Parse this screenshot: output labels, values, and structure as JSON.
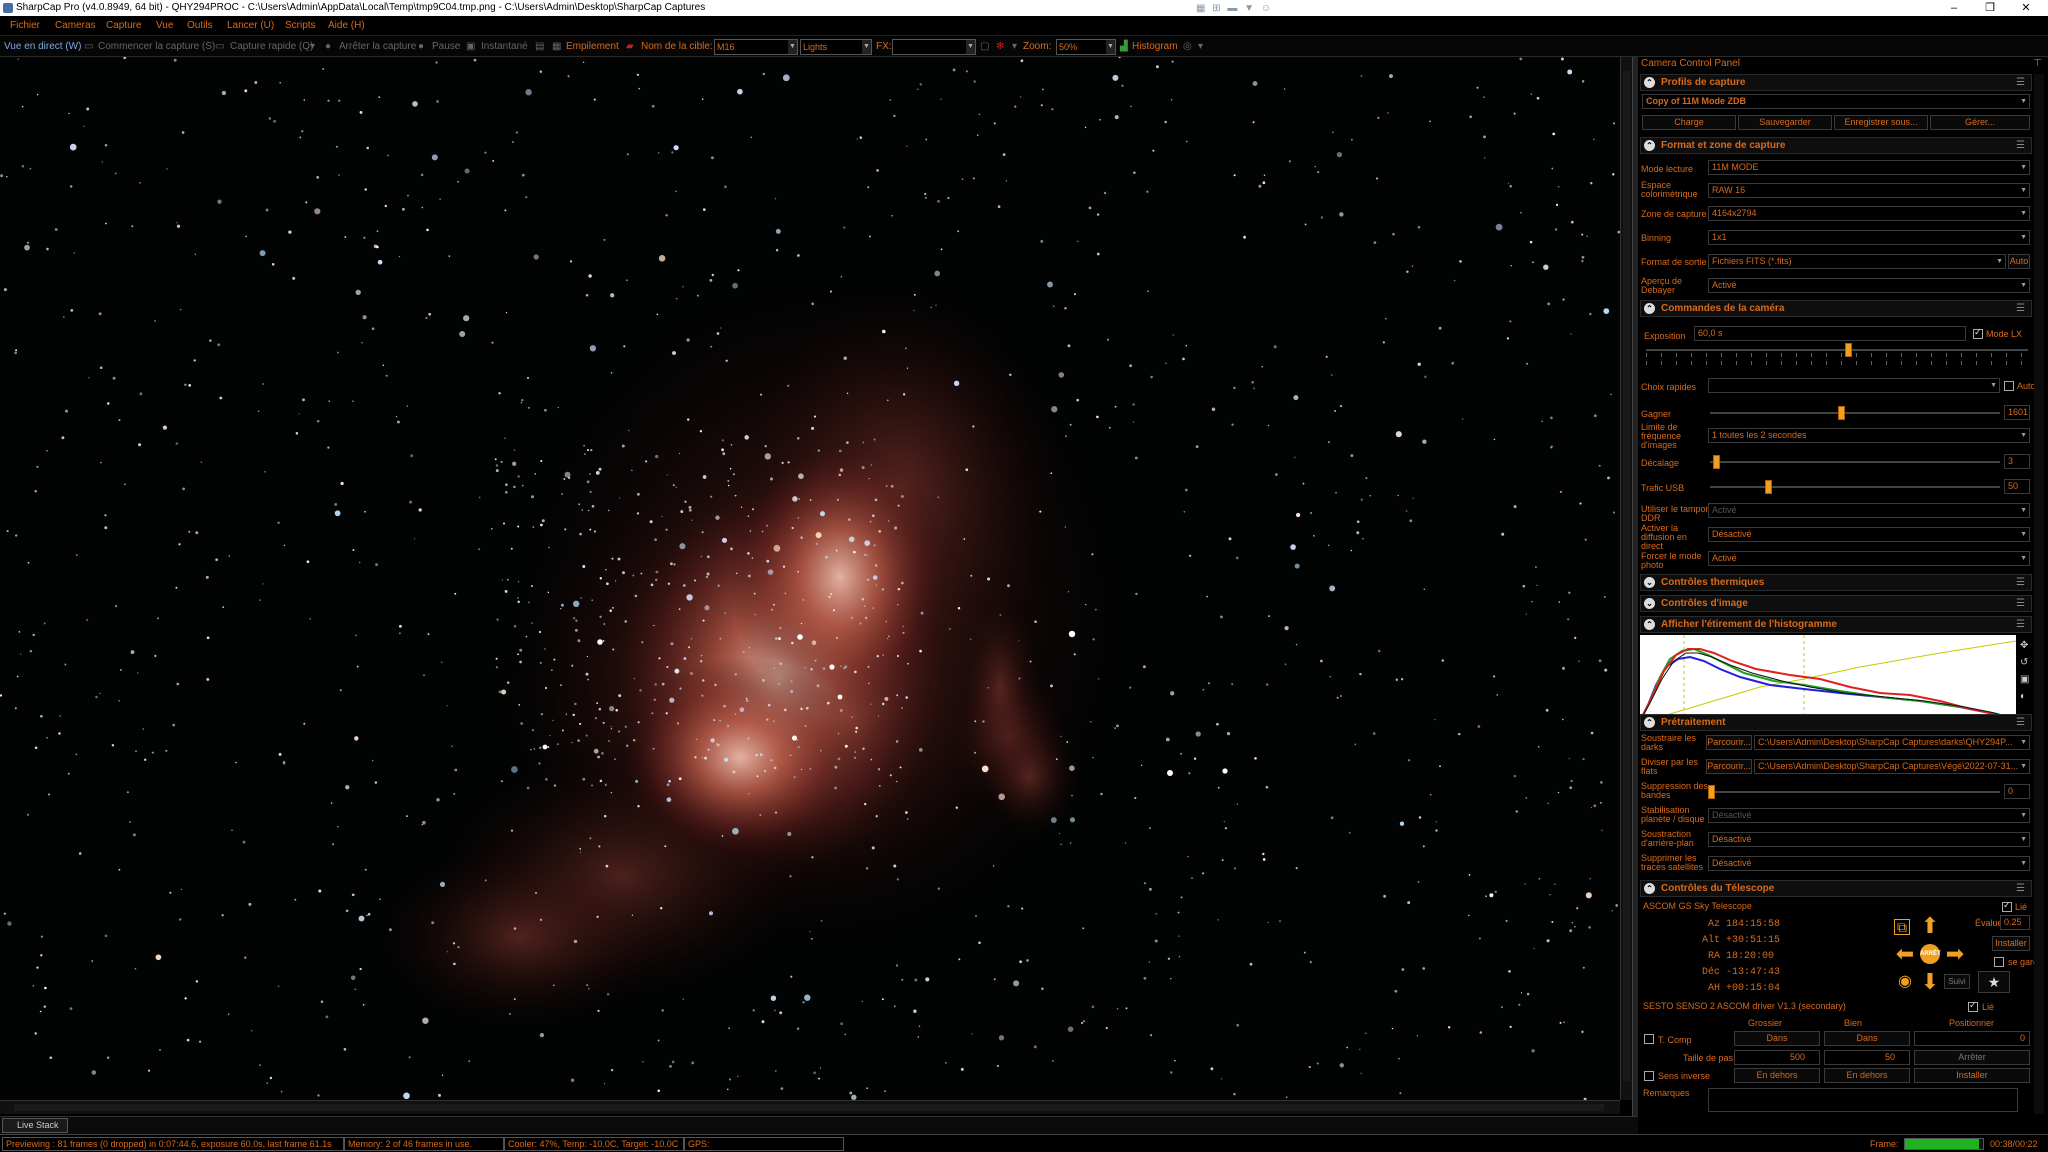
{
  "window": {
    "title": "SharpCap Pro (v4.0.8949, 64 bit) - QHY294PROC - C:\\Users\\Admin\\AppData\\Local\\Temp\\tmp9C04.tmp.png - C:\\Users\\Admin\\Desktop\\SharpCap Captures",
    "min": "–",
    "max": "❐",
    "close": "✕",
    "extra_icons": "▦ ⊞ ▬ ▼ ☺"
  },
  "menu": [
    "Fichier",
    "Cameras",
    "Capture",
    "Vue",
    "Outils",
    "Lancer (U)",
    "Scripts",
    "Aide (H)"
  ],
  "toolbar": {
    "live": "Vue en direct (W)",
    "start_capture": "Commencer la capture (S)",
    "quick_capture": "Capture rapide (Q)",
    "stop_capture": "Arrêter la capture",
    "pause": "Pause",
    "snapshot": "Instantané",
    "stack": "Empilement",
    "target_label": "Nom de la cible:",
    "target_value": "M16",
    "frame_type": "Lights",
    "fx_label": "FX:",
    "fx_value": "",
    "zoom_label": "Zoom:",
    "zoom_value": "50%",
    "histogram": "Histogram"
  },
  "bottom_tab": "Live Stack",
  "status": {
    "preview": "Previewing : 81 frames (0 dropped) in 0:07:44.6, exposure 60.0s, last frame 61.1s",
    "memory": "Memory: 2 of 46 frames in use.",
    "cooler": "Cooler: 47%, Temp: -10.0C, Target: -10.0C",
    "gps": "GPS:",
    "frame_label": "Frame:",
    "frame_progress": 0.95,
    "frame_time": "00:38/00:22"
  },
  "panel": {
    "title": "Camera Control Panel",
    "pin": "⊤",
    "profiles": {
      "header": "Profils de capture",
      "value": "Copy of 11M Mode ZDB",
      "buttons": [
        "Charge",
        "Sauvegarder",
        "Enregistrer sous...",
        "Gérer..."
      ]
    },
    "format": {
      "header": "Format et zone de capture",
      "rows": [
        {
          "label": "Mode lecture",
          "value": "11M MODE"
        },
        {
          "label": "Espace colorimétrique",
          "value": "RAW 16"
        },
        {
          "label": "Zone de capture",
          "value": "4164x2794"
        },
        {
          "label": "Binning",
          "value": "1x1"
        },
        {
          "label": "Format de sortie",
          "value": "Fichiers FITS (*.fits)",
          "extra": "Auto"
        },
        {
          "label": "Aperçu de Debayer",
          "value": "Activé"
        }
      ]
    },
    "camera": {
      "header": "Commandes de la caméra",
      "exposure_label": "Exposition",
      "exposure_value": "60,0 s",
      "lx_label": "Mode LX",
      "quick_label": "Choix rapides",
      "quick_value": "",
      "auto_label": "Auto",
      "gain_label": "Gagner",
      "gain_value": "1601",
      "gain_level": 0.45,
      "limit_label": "Limite de fréquence d'images",
      "limit_value": "1 toutes les 2 secondes",
      "offset_label": "Décalage",
      "offset_value": "3",
      "offset_level": 0.02,
      "usb_label": "Trafic USB",
      "usb_value": "50",
      "usb_level": 0.2,
      "exposure_level": 0.53,
      "ddr_label": "Utiliser le tampon DDR",
      "ddr_value": "Activé",
      "diffusion_label": "Activer la diffusion en direct",
      "diffusion_value": "Désactivé",
      "photo_label": "Forcer le mode photo",
      "photo_value": "Activé"
    },
    "thermal_header": "Contrôles thermiques",
    "image_header": "Contrôles d'image",
    "histogram_header": "Afficher l'étirement de l'histogramme",
    "preprocessing": {
      "header": "Prétraitement",
      "browse": "Parcourir...",
      "darks_label": "Soustraire les darks",
      "darks_value": "C:\\Users\\Admin\\Desktop\\SharpCap Captures\\darks\\QHY294P...",
      "flats_label": "Diviser par les flats",
      "flats_value": "C:\\Users\\Admin\\Desktop\\SharpCap Captures\\Végé\\2022-07-31...",
      "banding_label": "Suppression des bandes",
      "banding_value": "0",
      "stab_label": "Stabilisation planète / disque",
      "stab_value": "Désactivé",
      "bg_label": "Soustraction d'arrière-plan",
      "bg_value": "Désactivé",
      "sat_label": "Supprimer les traces satellites",
      "sat_value": "Désactivé"
    },
    "telescope": {
      "header": "Contrôles du Télescope",
      "mount": "ASCOM GS Sky Telescope",
      "linked": "Lié",
      "coords": [
        {
          "k": "Az",
          "v": "184:15:58"
        },
        {
          "k": "Alt",
          "v": "+30:51:15"
        },
        {
          "k": "RA",
          "v": "18:20:00"
        },
        {
          "k": "Déc",
          "v": "-13:47:43"
        },
        {
          "k": "AH",
          "v": "+00:15:04"
        }
      ],
      "rate_label": "Évaluer",
      "rate_value": "0.25",
      "install": "Installer",
      "park": "se garer",
      "follow": "Suivi",
      "stop_label": "ARRÊT",
      "focuser": "SESTO SENSO 2 ASCOM driver V1.3 (secondary)",
      "focuser_linked": "Lié",
      "col_coarse": "Grossier",
      "col_fine": "Bien",
      "col_pos": "Positionner",
      "in": "Dans",
      "out": "En dehors",
      "pos_value": "0",
      "tcomp": "T. Comp",
      "step_label": "Taille de pas",
      "coarse_step": "500",
      "fine_step": "50",
      "stop": "Arrêter",
      "reverse": "Sens inverse",
      "install2": "Installer"
    },
    "notes_label": "Remarques"
  }
}
